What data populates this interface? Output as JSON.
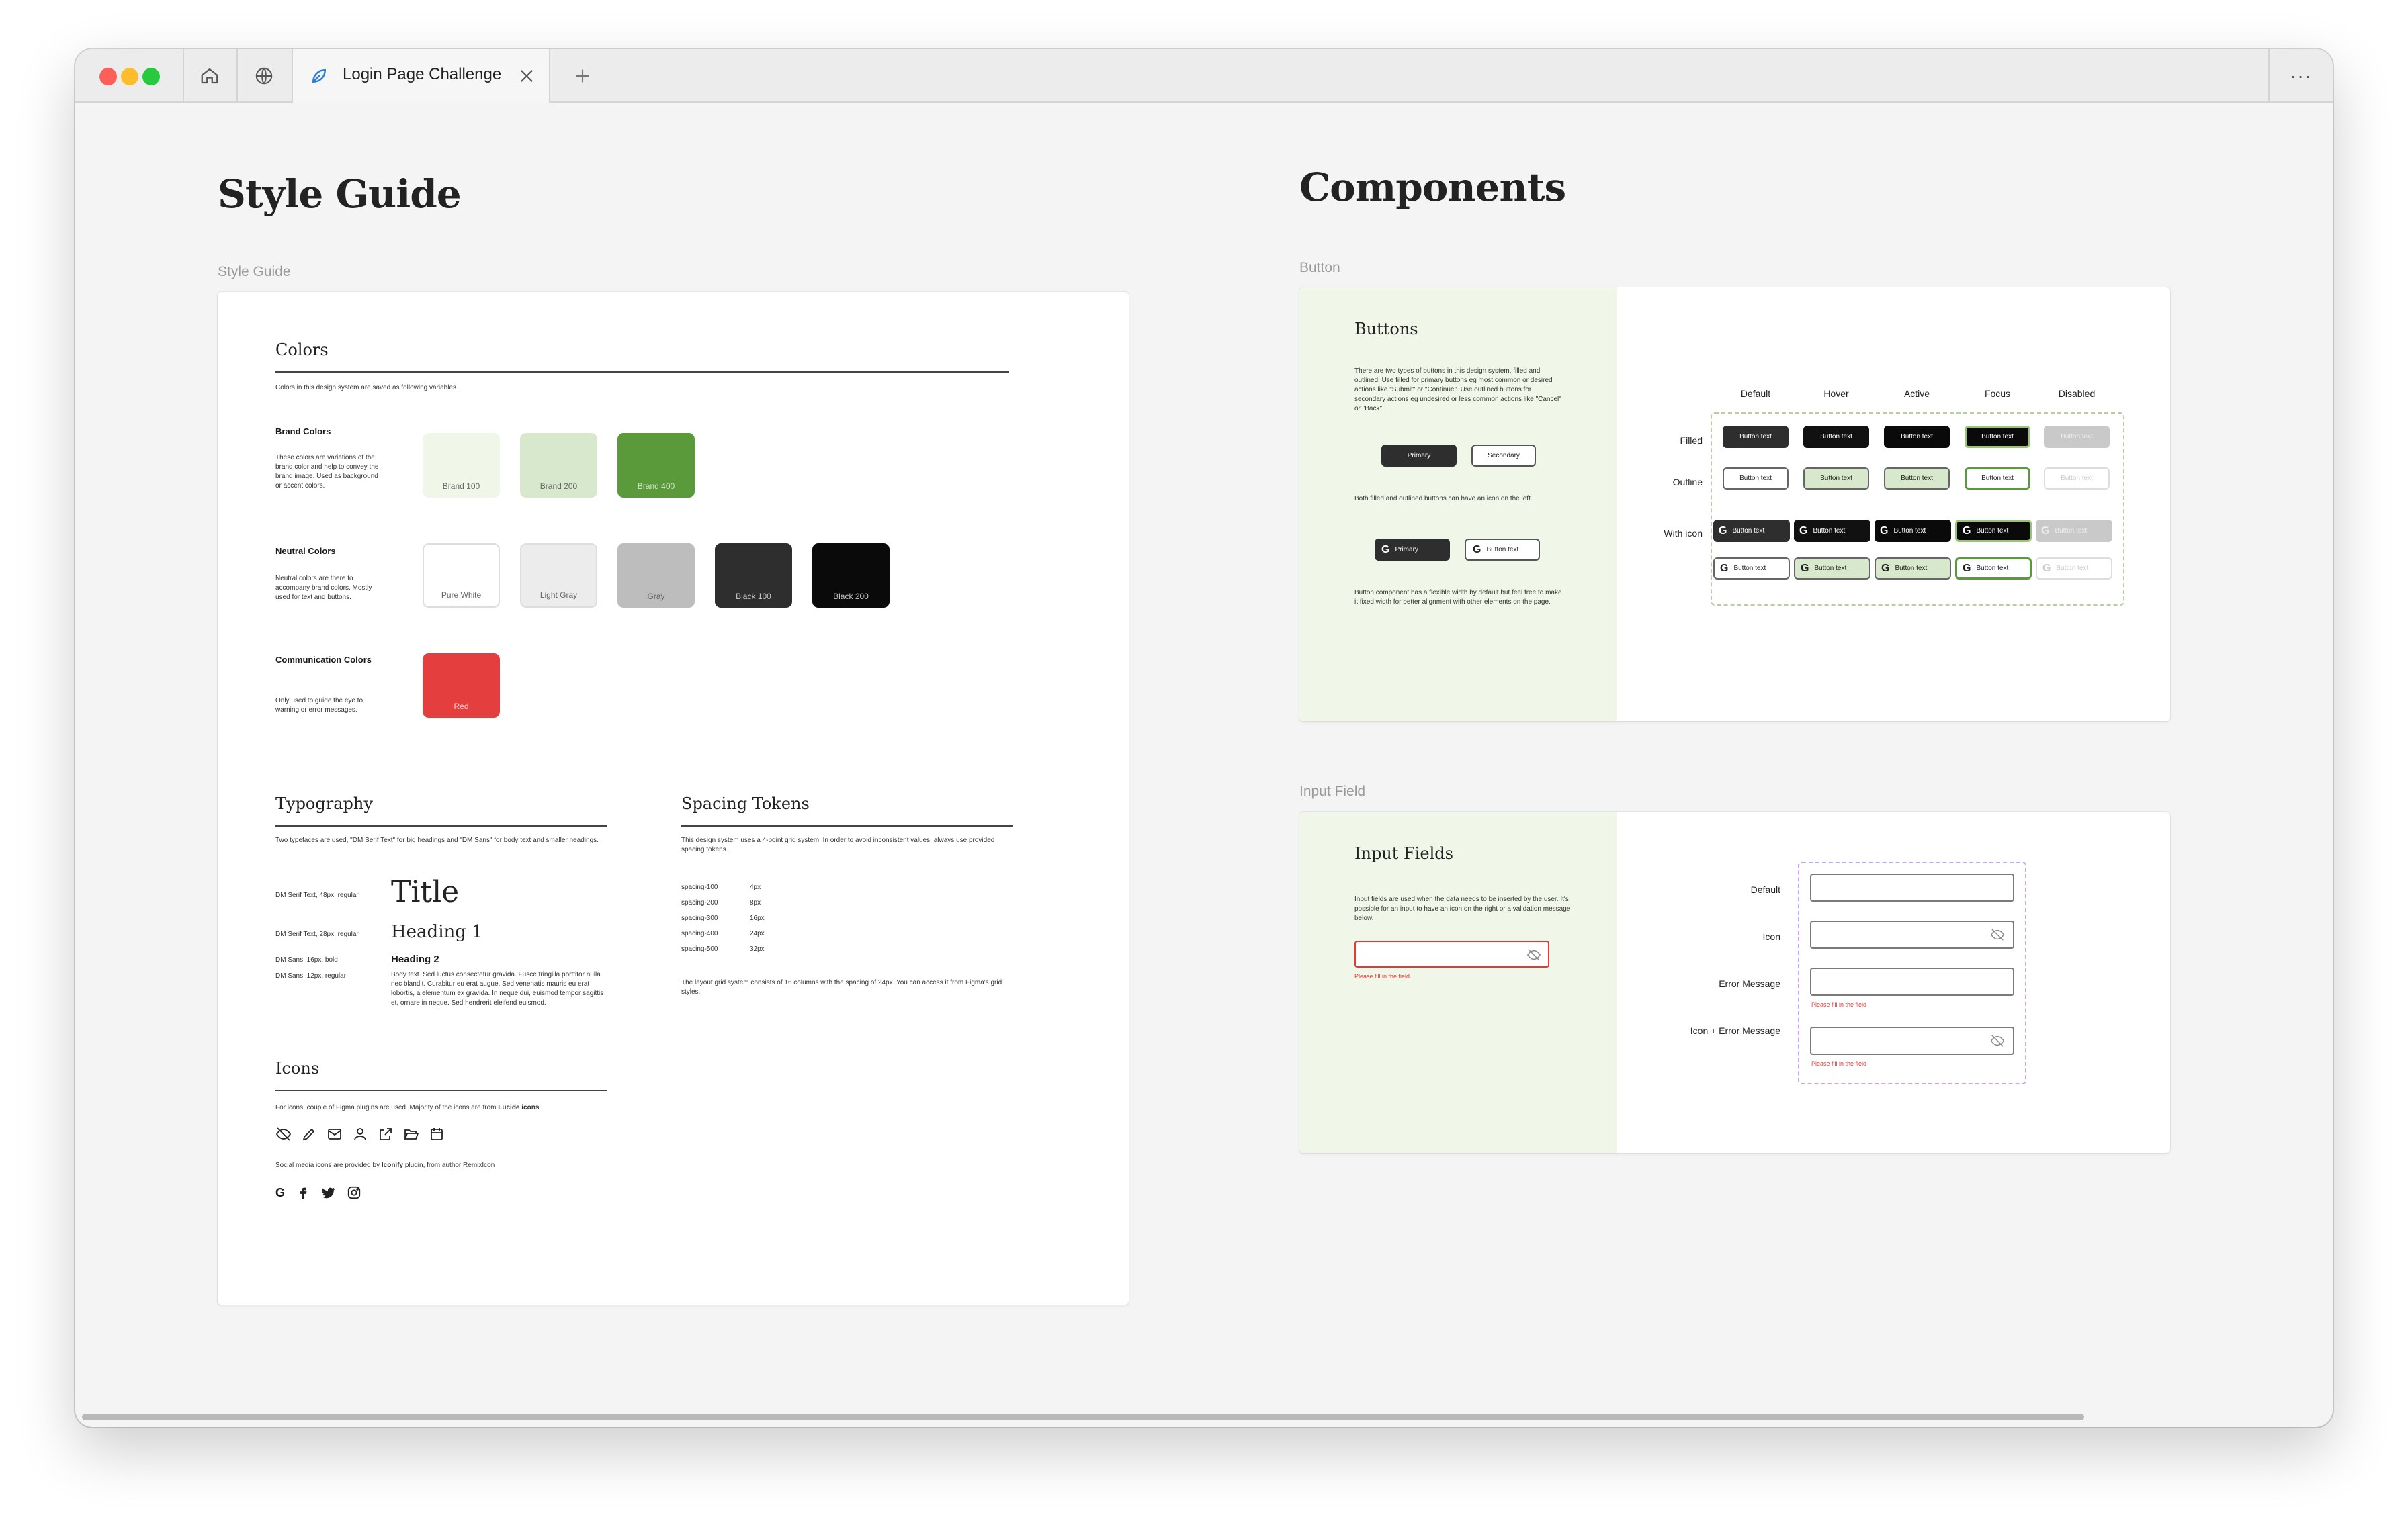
{
  "browser": {
    "tab_title": "Login Page Challenge",
    "more": "···"
  },
  "style_guide": {
    "page_title": "Style Guide",
    "frame_label": "Style Guide",
    "colors": {
      "title": "Colors",
      "desc": "Colors in this design system are saved as following variables.",
      "brand": {
        "title": "Brand Colors",
        "desc": "These colors are variations of the brand color and help to convey the brand image. Used as background or accent colors.",
        "swatches": [
          {
            "name": "Brand 100",
            "color": "#f0f7e8"
          },
          {
            "name": "Brand 200",
            "color": "#d8e8cc"
          },
          {
            "name": "Brand 400",
            "color": "#5a9a3a"
          }
        ]
      },
      "neutral": {
        "title": "Neutral Colors",
        "desc": "Neutral colors are there to accompany brand colors. Mostly used for text and buttons.",
        "swatches": [
          {
            "name": "Pure White",
            "color": "#ffffff"
          },
          {
            "name": "Light Gray",
            "color": "#ececec"
          },
          {
            "name": "Gray",
            "color": "#bdbdbd"
          },
          {
            "name": "Black 100",
            "color": "#2e2e2e"
          },
          {
            "name": "Black 200",
            "color": "#0a0a0a"
          }
        ]
      },
      "communication": {
        "title": "Communication Colors",
        "desc": "Only used to guide the eye to warning or error messages.",
        "swatches": [
          {
            "name": "Red",
            "color": "#e53e3e"
          }
        ]
      }
    },
    "typography": {
      "title": "Typography",
      "desc": "Two typefaces are used, \"DM Serif Text\" for big headings and \"DM Sans\" for body text and smaller headings.",
      "rows": [
        {
          "label": "DM Serif Text, 48px, regular",
          "sample": "Title"
        },
        {
          "label": "DM Serif Text, 28px, regular",
          "sample": "Heading 1"
        },
        {
          "label": "DM Sans, 16px, bold",
          "sample": "Heading 2"
        },
        {
          "label": "DM Sans, 12px, regular",
          "sample": "Body text. Sed luctus consectetur gravida. Fusce fringilla porttitor nulla nec blandit. Curabitur eu erat augue. Sed venenatis mauris eu erat lobortis, a elementum ex gravida. In neque dui, euismod tempor sagittis et, ornare in neque. Sed hendrerit eleifend euismod."
        }
      ]
    },
    "spacing": {
      "title": "Spacing Tokens",
      "desc": "This design system uses a 4-point grid system. In order to avoid inconsistent values, always use provided spacing tokens.",
      "tokens": [
        {
          "name": "spacing-100",
          "value": "4px"
        },
        {
          "name": "spacing-200",
          "value": "8px"
        },
        {
          "name": "spacing-300",
          "value": "16px"
        },
        {
          "name": "spacing-400",
          "value": "24px"
        },
        {
          "name": "spacing-500",
          "value": "32px"
        }
      ],
      "grid_note": "The layout grid system consists of 16 columns with the spacing of 24px. You can access it from Figma's grid styles."
    },
    "icons": {
      "title": "Icons",
      "desc_pre": "For icons, couple of Figma plugins are used. Majority of the icons are from ",
      "desc_bold": "Lucide icons",
      "desc_post": ".",
      "social_pre": "Social media icons are provided by ",
      "social_bold": "Iconify",
      "social_mid": " plugin, from author ",
      "social_link": "RemixIcon",
      "set": [
        "eye-off-icon",
        "pencil-icon",
        "mail-icon",
        "user-icon",
        "external-link-icon",
        "folder-open-icon",
        "calendar-icon"
      ],
      "social": [
        "google-icon",
        "facebook-icon",
        "twitter-icon",
        "instagram-icon"
      ]
    }
  },
  "components": {
    "page_title": "Components",
    "button_frame_label": "Button",
    "input_frame_label": "Input Field",
    "buttons": {
      "title": "Buttons",
      "desc": "There are two types of buttons in this design system, filled and outlined. Use filled for primary buttons eg most common or desired actions like \"Submit\" or \"Continue\". Use outlined buttons for secondary actions eg undesired or less common actions like \"Cancel\" or \"Back\".",
      "primary": "Primary",
      "secondary": "Secondary",
      "icon_note": "Both filled and outlined buttons can have an icon on the left.",
      "icon_primary": "Primary",
      "icon_secondary": "Button text",
      "width_note": "Button component has a flexible width by default but feel free to make it fixed width for better alignment with other elements on the page.",
      "states": [
        "Default",
        "Hover",
        "Active",
        "Focus",
        "Disabled"
      ],
      "rows": [
        "Filled",
        "Outline",
        "With icon"
      ],
      "button_text": "Button text",
      "google_glyph": "G"
    },
    "inputs": {
      "title": "Input Fields",
      "desc": "Input fields are used when the data needs to be inserted by the user. It's possible for an input to have an icon on the right or a validation message below.",
      "error": "Please fill in the field",
      "labels": [
        "Default",
        "Icon",
        "Error Message",
        "Icon + Error Message"
      ]
    }
  },
  "colors": {
    "panel_green": "#f0f7e8",
    "dashed_green": "#b7cf9a",
    "dashed_purple": "#c6a8f0",
    "error_red": "#e53935"
  }
}
